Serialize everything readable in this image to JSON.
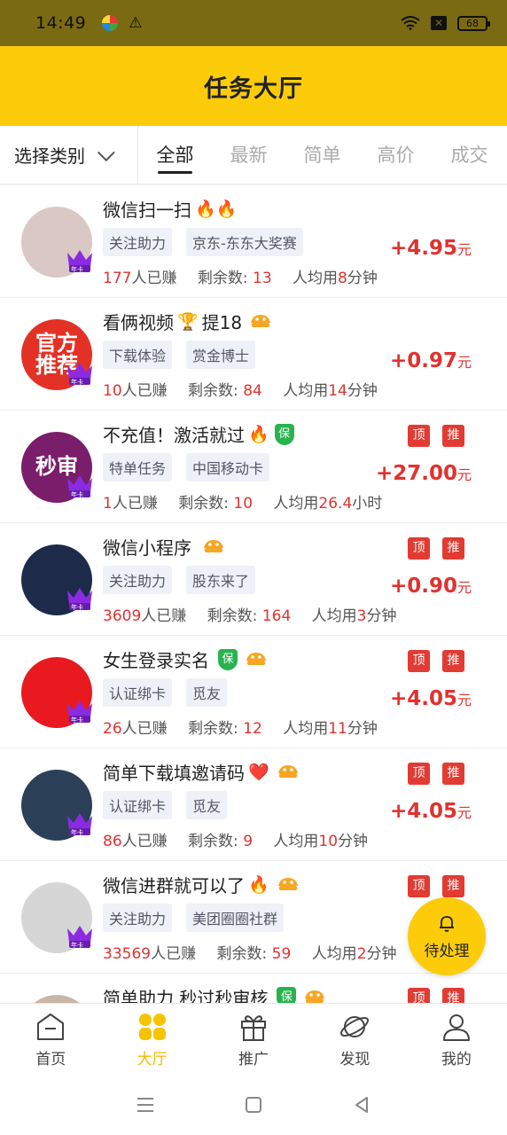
{
  "status_bar": {
    "time": "14:49",
    "battery": "68"
  },
  "header": {
    "title": "任务大厅"
  },
  "filter": {
    "category_label": "选择类别",
    "tabs": [
      {
        "label": "全部",
        "active": true
      },
      {
        "label": "最新",
        "active": false
      },
      {
        "label": "简单",
        "active": false
      },
      {
        "label": "高价",
        "active": false
      },
      {
        "label": "成交",
        "active": false
      }
    ]
  },
  "tasks": [
    {
      "title": "微信扫一扫",
      "title_emojis": "🔥🔥",
      "shield": false,
      "fast": false,
      "tags": [
        "关注助力",
        "京东-东东大奖赛"
      ],
      "earned_count": "177",
      "earned_label": "人已赚",
      "remaining_label": "剩余数:",
      "remaining": "13",
      "avg_label": "人均用",
      "avg_value": "8",
      "avg_unit": "分钟",
      "reward": "+4.95",
      "reward_unit": "元",
      "flags": [],
      "avatar_color": "#d9c8c4",
      "avatar_text": "",
      "crown_label": "年卡"
    },
    {
      "title": "看俩视频",
      "title_emojis": "🏆",
      "title_suffix": "提18",
      "shield": false,
      "fast": true,
      "tags": [
        "下载体验",
        "赏金博士"
      ],
      "earned_count": "10",
      "earned_label": "人已赚",
      "remaining_label": "剩余数:",
      "remaining": "84",
      "avg_label": "人均用",
      "avg_value": "14",
      "avg_unit": "分钟",
      "reward": "+0.97",
      "reward_unit": "元",
      "flags": [],
      "avatar_color": "#e33225",
      "avatar_text": "官方\n推荐",
      "crown_label": "年卡"
    },
    {
      "title": "不充值！激活就过",
      "title_emojis": "🔥",
      "shield": true,
      "fast": false,
      "tags": [
        "特单任务",
        "中国移动卡"
      ],
      "earned_count": "1",
      "earned_label": "人已赚",
      "remaining_label": "剩余数:",
      "remaining": "10",
      "avg_label": "人均用",
      "avg_value": "26.4",
      "avg_unit": "小时",
      "reward": "+27.00",
      "reward_unit": "元",
      "flags": [
        "顶",
        "推"
      ],
      "avatar_color": "#7a1d6a",
      "avatar_text": "秒审",
      "crown_label": "年卡"
    },
    {
      "title": "微信小程序",
      "title_emojis": "",
      "shield": false,
      "fast": true,
      "tags": [
        "关注助力",
        "股东来了"
      ],
      "earned_count": "3609",
      "earned_label": "人已赚",
      "remaining_label": "剩余数:",
      "remaining": "164",
      "avg_label": "人均用",
      "avg_value": "3",
      "avg_unit": "分钟",
      "reward": "+0.90",
      "reward_unit": "元",
      "flags": [
        "顶",
        "推"
      ],
      "avatar_color": "#1d2a4a",
      "avatar_text": "",
      "crown_label": "年卡"
    },
    {
      "title": "女生登录实名",
      "title_emojis": "",
      "shield": true,
      "fast": true,
      "tags": [
        "认证绑卡",
        "觅友"
      ],
      "earned_count": "26",
      "earned_label": "人已赚",
      "remaining_label": "剩余数:",
      "remaining": "12",
      "avg_label": "人均用",
      "avg_value": "11",
      "avg_unit": "分钟",
      "reward": "+4.05",
      "reward_unit": "元",
      "flags": [
        "顶",
        "推"
      ],
      "avatar_color": "#e8191f",
      "avatar_text": "",
      "crown_label": "年卡"
    },
    {
      "title": "简单下载填邀请码",
      "title_emojis": "❤️",
      "shield": false,
      "fast": true,
      "tags": [
        "认证绑卡",
        "觅友"
      ],
      "earned_count": "86",
      "earned_label": "人已赚",
      "remaining_label": "剩余数:",
      "remaining": "9",
      "avg_label": "人均用",
      "avg_value": "10",
      "avg_unit": "分钟",
      "reward": "+4.05",
      "reward_unit": "元",
      "flags": [
        "顶",
        "推"
      ],
      "avatar_color": "#2b3f57",
      "avatar_text": "",
      "crown_label": "年卡"
    },
    {
      "title": "微信进群就可以了",
      "title_emojis": "🔥",
      "shield": false,
      "fast": true,
      "tags": [
        "关注助力",
        "美团圈圈社群"
      ],
      "earned_count": "33569",
      "earned_label": "人已赚",
      "remaining_label": "剩余数:",
      "remaining": "59",
      "avg_label": "人均用",
      "avg_value": "2",
      "avg_unit": "分钟",
      "reward": "+",
      "reward_unit": "",
      "flags": [
        "顶",
        "推"
      ],
      "avatar_color": "#d6d6d6",
      "avatar_text": "",
      "crown_label": "年卡"
    },
    {
      "title": "简单助力 秒过秒审核",
      "title_emojis": "",
      "shield": true,
      "fast": true,
      "tags": [],
      "earned_count": "",
      "earned_label": "",
      "remaining_label": "",
      "remaining": "",
      "avg_label": "",
      "avg_value": "",
      "avg_unit": "",
      "reward": "",
      "reward_unit": "",
      "flags": [
        "顶",
        "推"
      ],
      "avatar_color": "#c8b6a6",
      "avatar_text": "",
      "crown_label": ""
    }
  ],
  "pending": {
    "label": "待处理"
  },
  "bottom_nav": [
    {
      "label": "首页",
      "icon": "home-icon",
      "active": false
    },
    {
      "label": "大厅",
      "icon": "hall-icon",
      "active": true
    },
    {
      "label": "推广",
      "icon": "gift-icon",
      "active": false
    },
    {
      "label": "发现",
      "icon": "planet-icon",
      "active": false
    },
    {
      "label": "我的",
      "icon": "user-icon",
      "active": false
    }
  ],
  "colors": {
    "brand_yellow": "#fccc0a",
    "price_red": "#e0322f",
    "status_bar": "#7a6a12"
  }
}
